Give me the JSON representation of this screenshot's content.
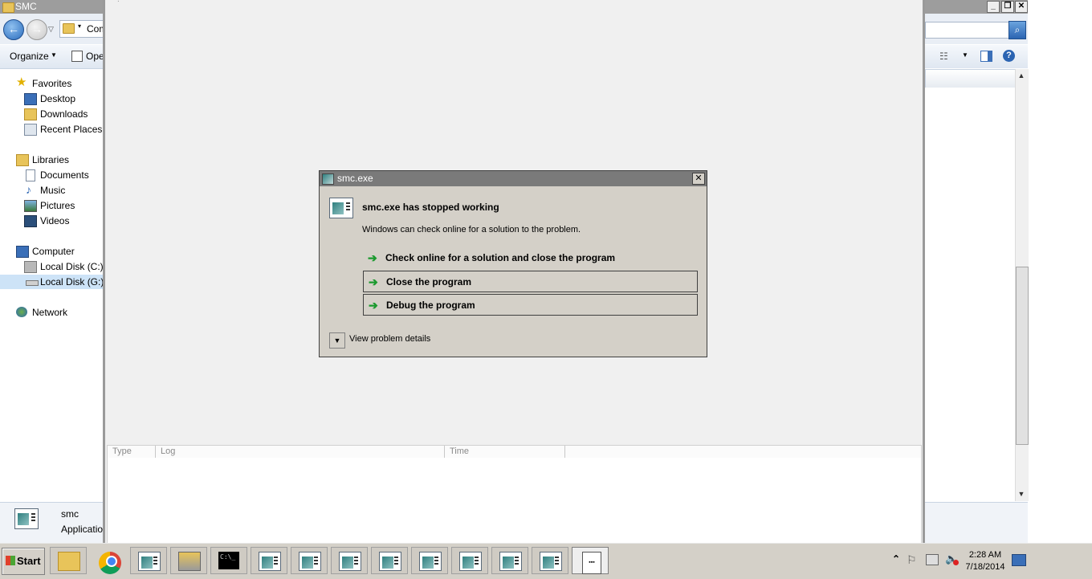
{
  "explorer": {
    "title": "SMC",
    "address_fragment": "Com",
    "toolbar": {
      "organize": "Organize",
      "open": "Ope"
    },
    "nav": {
      "favorites": "Favorites",
      "desktop": "Desktop",
      "downloads": "Downloads",
      "recent": "Recent Places",
      "libraries": "Libraries",
      "documents": "Documents",
      "music": "Music",
      "pictures": "Pictures",
      "videos": "Videos",
      "computer": "Computer",
      "disk_c": "Local Disk (C:)",
      "disk_g": "Local Disk (G:)",
      "network": "Network"
    },
    "details": {
      "name": "smc",
      "type": "Application"
    },
    "caption_buttons": {
      "minimize": "_",
      "restore": "❐",
      "close": "✕"
    }
  },
  "app_log": {
    "columns": [
      "Type",
      "Log",
      "Time"
    ]
  },
  "dialog": {
    "title": "smc.exe",
    "heading": "smc.exe has stopped working",
    "message": "Windows can check online for a solution to the problem.",
    "options": [
      "Check online for a solution and close the program",
      "Close the program",
      "Debug the program"
    ],
    "details_label": "View problem details",
    "close_glyph": "✕"
  },
  "taskbar": {
    "start_label": "Start",
    "clock_time": "2:28 AM",
    "clock_date": "7/18/2014",
    "items": [
      "explorer",
      "chrome",
      "app",
      "server-manager",
      "cmd",
      "app",
      "app",
      "app",
      "app",
      "app",
      "app",
      "app",
      "app",
      "werfault"
    ]
  },
  "colors": {
    "title_gray": "#9d9d9d",
    "dialog_face": "#d4d0c8",
    "option_arrow": "#1b9a2e"
  }
}
